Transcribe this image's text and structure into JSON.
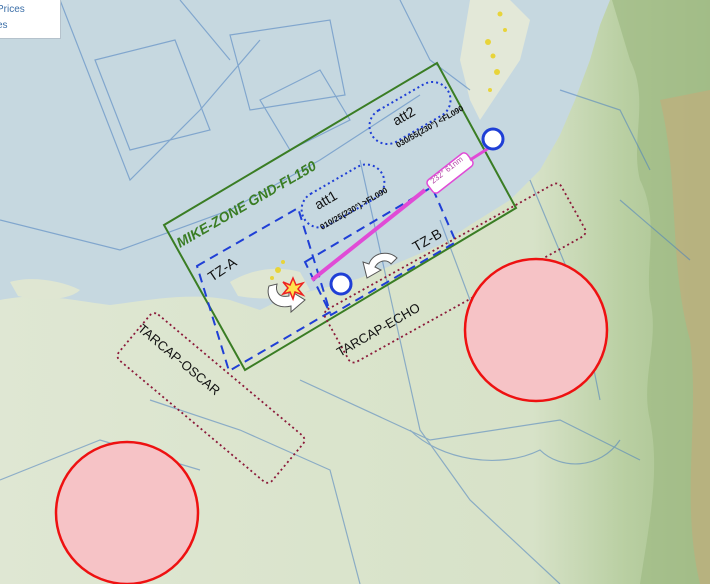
{
  "legend": {
    "line1": "Prices",
    "line2": "es"
  },
  "zones": {
    "mike": "MIKE-ZONE GND-FL150",
    "tarcap_oscar": "TARCAP-OSCAR",
    "tarcap_echo": "TARCAP-ECHO",
    "tz_a": "TZ-A",
    "tz_b": "TZ-B",
    "att1": "att1",
    "att2": "att2"
  },
  "annotations": {
    "att1_info": "010/25(230°) >FL090",
    "att2_info": "030/55(230°) <FL090",
    "bearing": "232° 61nm"
  },
  "colors": {
    "mike_zone": "#3a7d24",
    "tz_dash": "#1f3fd6",
    "tarcap": "#8b1a3a",
    "route": "#e04bd6",
    "threat_fill": "#f6c3c6",
    "threat_stroke": "#ee1111"
  }
}
